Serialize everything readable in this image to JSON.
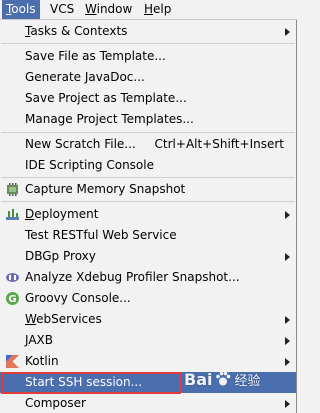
{
  "menubar": {
    "items": [
      {
        "label": "Tools",
        "mnemonic": "T",
        "rest": "ools"
      },
      {
        "label": "VCS",
        "mnemonic": "",
        "rest": "VCS"
      },
      {
        "label": "Window",
        "mnemonic": "W",
        "rest": "indow"
      },
      {
        "label": "Help",
        "mnemonic": "H",
        "rest": "elp"
      }
    ]
  },
  "tools_menu": {
    "items": [
      {
        "label": "Tasks & Contexts",
        "mnemonic_prefix": "",
        "mnemonic": "T",
        "rest": "asks & Contexts",
        "submenu": true
      },
      {
        "label": "Save File as Template..."
      },
      {
        "label": "Generate JavaDoc..."
      },
      {
        "label": "Save Project as Template..."
      },
      {
        "label": "Manage Project Templates..."
      },
      {
        "label": "New Scratch File...",
        "shortcut": "Ctrl+Alt+Shift+Insert"
      },
      {
        "label": "IDE Scripting Console"
      },
      {
        "label": "Capture Memory Snapshot",
        "icon": "memory-snapshot-icon"
      },
      {
        "label": "Deployment",
        "mnemonic": "D",
        "rest": "eployment",
        "submenu": true,
        "icon": "deployment-icon"
      },
      {
        "label": "Test RESTful Web Service"
      },
      {
        "label": "DBGp Proxy",
        "submenu": true
      },
      {
        "label": "Analyze Xdebug Profiler Snapshot...",
        "icon": "php-icon"
      },
      {
        "label": "Groovy Console...",
        "icon": "groovy-icon"
      },
      {
        "label": "WebServices",
        "mnemonic": "W",
        "rest": "ebServices",
        "submenu": true
      },
      {
        "label": "JAXB",
        "mnemonic": "J",
        "rest": "AXB",
        "submenu": true
      },
      {
        "label": "Kotlin",
        "submenu": true,
        "icon": "kotlin-icon"
      },
      {
        "label": "Start SSH session...",
        "selected": true
      },
      {
        "label": "Composer",
        "submenu": true
      }
    ]
  },
  "watermark": {
    "text": "Bai",
    "text_cn": "经验"
  },
  "colors": {
    "selection": "#4b6eaf",
    "highlight_box": "#e03c3c",
    "menu_bg": "#f2f2f2"
  }
}
